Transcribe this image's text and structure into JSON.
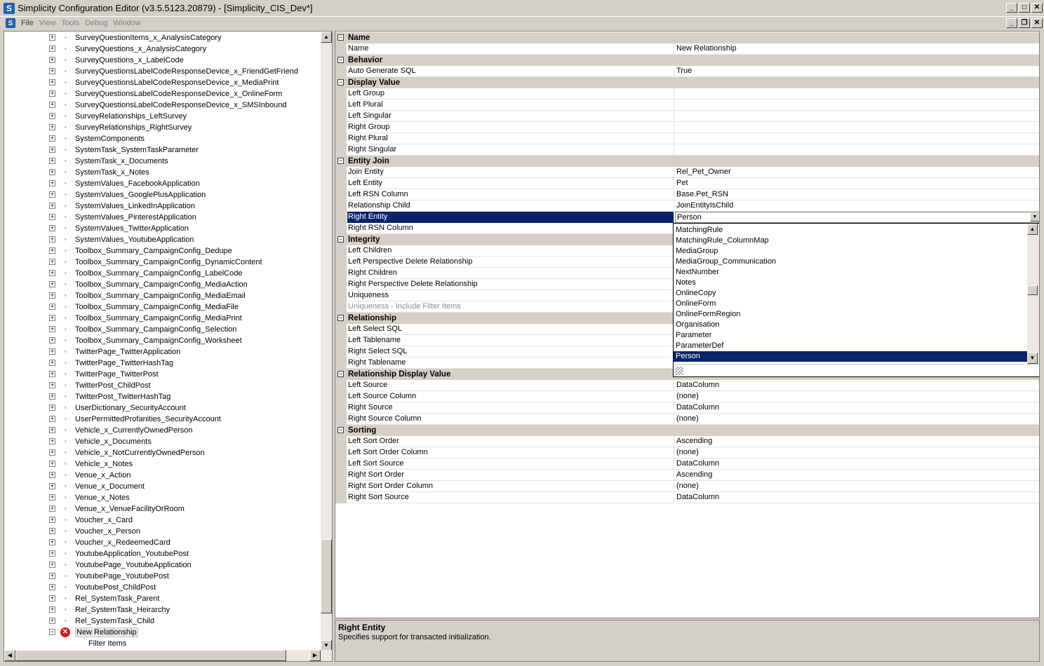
{
  "window": {
    "title": "Simplicity Configuration Editor (v3.5.5123.20879) - [Simplicity_CIS_Dev*]",
    "icon_letter": "S"
  },
  "menu": [
    "File",
    "View",
    "Tools",
    "Debug",
    "Window"
  ],
  "tree": {
    "items": [
      "SurveyQuestionItems_x_AnalysisCategory",
      "SurveyQuestions_x_AnalysisCategory",
      "SurveyQuestions_x_LabelCode",
      "SurveyQuestionsLabelCodeResponseDevice_x_FriendGetFriend",
      "SurveyQuestionsLabelCodeResponseDevice_x_MediaPrint",
      "SurveyQuestionsLabelCodeResponseDevice_x_OnlineForm",
      "SurveyQuestionsLabelCodeResponseDevice_x_SMSInbound",
      "SurveyRelationships_LeftSurvey",
      "SurveyRelationships_RightSurvey",
      "SystemComponents",
      "SystemTask_SystemTaskParameter",
      "SystemTask_x_Documents",
      "SystemTask_x_Notes",
      "SystemValues_FacebookApplication",
      "SystemValues_GooglePlusApplication",
      "SystemValues_LinkedInApplication",
      "SystemValues_PinterestApplication",
      "SystemValues_TwitterApplication",
      "SystemValues_YoutubeApplication",
      "Toolbox_Summary_CampaignConfig_Dedupe",
      "Toolbox_Summary_CampaignConfig_DynamicContent",
      "Toolbox_Summary_CampaignConfig_LabelCode",
      "Toolbox_Summary_CampaignConfig_MediaAction",
      "Toolbox_Summary_CampaignConfig_MediaEmail",
      "Toolbox_Summary_CampaignConfig_MediaFile",
      "Toolbox_Summary_CampaignConfig_MediaPrint",
      "Toolbox_Summary_CampaignConfig_Selection",
      "Toolbox_Summary_CampaignConfig_Worksheet",
      "TwitterPage_TwitterApplication",
      "TwitterPage_TwitterHashTag",
      "TwitterPage_TwitterPost",
      "TwitterPost_ChildPost",
      "TwitterPost_TwitterHashTag",
      "UserDictionary_SecurityAccount",
      "UserPermittedProfanities_SecurityAccount",
      "Vehicle_x_CurrentlyOwnedPerson",
      "Vehicle_x_Documents",
      "Vehicle_x_NotCurrentlyOwnedPerson",
      "Vehicle_x_Notes",
      "Venue_x_Action",
      "Venue_x_Document",
      "Venue_x_Notes",
      "Venue_x_VenueFacilityOrRoom",
      "Voucher_x_Card",
      "Voucher_x_Person",
      "Voucher_x_RedeemedCard",
      "YoutubeApplication_YoutubePost",
      "YoutubePage_YoutubeApplication",
      "YoutubePage_YoutubePost",
      "YoutubePost_ChildPost",
      "Rel_SystemTask_Parent",
      "Rel_SystemTask_Heirarchy",
      "Rel_SystemTask_Child"
    ],
    "selected_item": "New Relationship",
    "child_item": "Filter Items"
  },
  "properties": [
    {
      "category": "Name",
      "rows": [
        [
          "Name",
          "New Relationship"
        ]
      ]
    },
    {
      "category": "Behavior",
      "rows": [
        [
          "Auto Generate SQL",
          "True"
        ]
      ]
    },
    {
      "category": "Display Value",
      "rows": [
        [
          "Left Group",
          ""
        ],
        [
          "Left Plural",
          ""
        ],
        [
          "Left Singular",
          ""
        ],
        [
          "Right Group",
          ""
        ],
        [
          "Right Plural",
          ""
        ],
        [
          "Right Singular",
          ""
        ]
      ]
    },
    {
      "category": "Entity Join",
      "rows": [
        [
          "Join Entity",
          "Rel_Pet_Owner"
        ],
        [
          "Left Entity",
          "Pet"
        ],
        [
          "Left RSN Column",
          "Base.Pet_RSN"
        ],
        [
          "Relationship Child",
          "JoinEntityIsChild"
        ],
        [
          "Right Entity",
          "Person"
        ],
        [
          "Right RSN Column",
          ""
        ]
      ]
    },
    {
      "category": "Integrity",
      "rows": [
        [
          "Left Children",
          ""
        ],
        [
          "Left Perspective Delete Relationship",
          ""
        ],
        [
          "Right Children",
          ""
        ],
        [
          "Right Perspective Delete Relationship",
          ""
        ],
        [
          "Uniqueness",
          ""
        ],
        [
          "Uniqueness - Include Filter Items",
          ""
        ]
      ]
    },
    {
      "category": "Relationship",
      "rows": [
        [
          "Left Select SQL",
          ""
        ],
        [
          "Left Tablename",
          ""
        ],
        [
          "Right Select SQL",
          ""
        ],
        [
          "Right Tablename",
          ""
        ]
      ]
    },
    {
      "category": "Relationship Display Value",
      "rows": [
        [
          "Left Source",
          "DataColumn"
        ],
        [
          "Left Source Column",
          "(none)"
        ],
        [
          "Right Source",
          "DataColumn"
        ],
        [
          "Right Source Column",
          "(none)"
        ]
      ]
    },
    {
      "category": "Sorting",
      "rows": [
        [
          "Left Sort Order",
          "Ascending"
        ],
        [
          "Left Sort Order Column",
          "(none)"
        ],
        [
          "Left Sort Source",
          "DataColumn"
        ],
        [
          "Right Sort Order",
          "Ascending"
        ],
        [
          "Right Sort Order Column",
          "(none)"
        ],
        [
          "Right Sort Source",
          "DataColumn"
        ]
      ]
    }
  ],
  "selected_property": "Right Entity",
  "disabled_property": "Uniqueness - Include Filter Items",
  "dropdown": {
    "items": [
      "MatchingRule",
      "MatchingRule_ColumnMap",
      "MediaGroup",
      "MediaGroup_Communication",
      "NextNumber",
      "Notes",
      "OnlineCopy",
      "OnlineForm",
      "OnlineFormRegion",
      "Organisation",
      "Parameter",
      "ParameterDef",
      "Person"
    ],
    "selected": "Person"
  },
  "help": {
    "title": "Right Entity",
    "description": "Specifies support for transacted initialization."
  }
}
